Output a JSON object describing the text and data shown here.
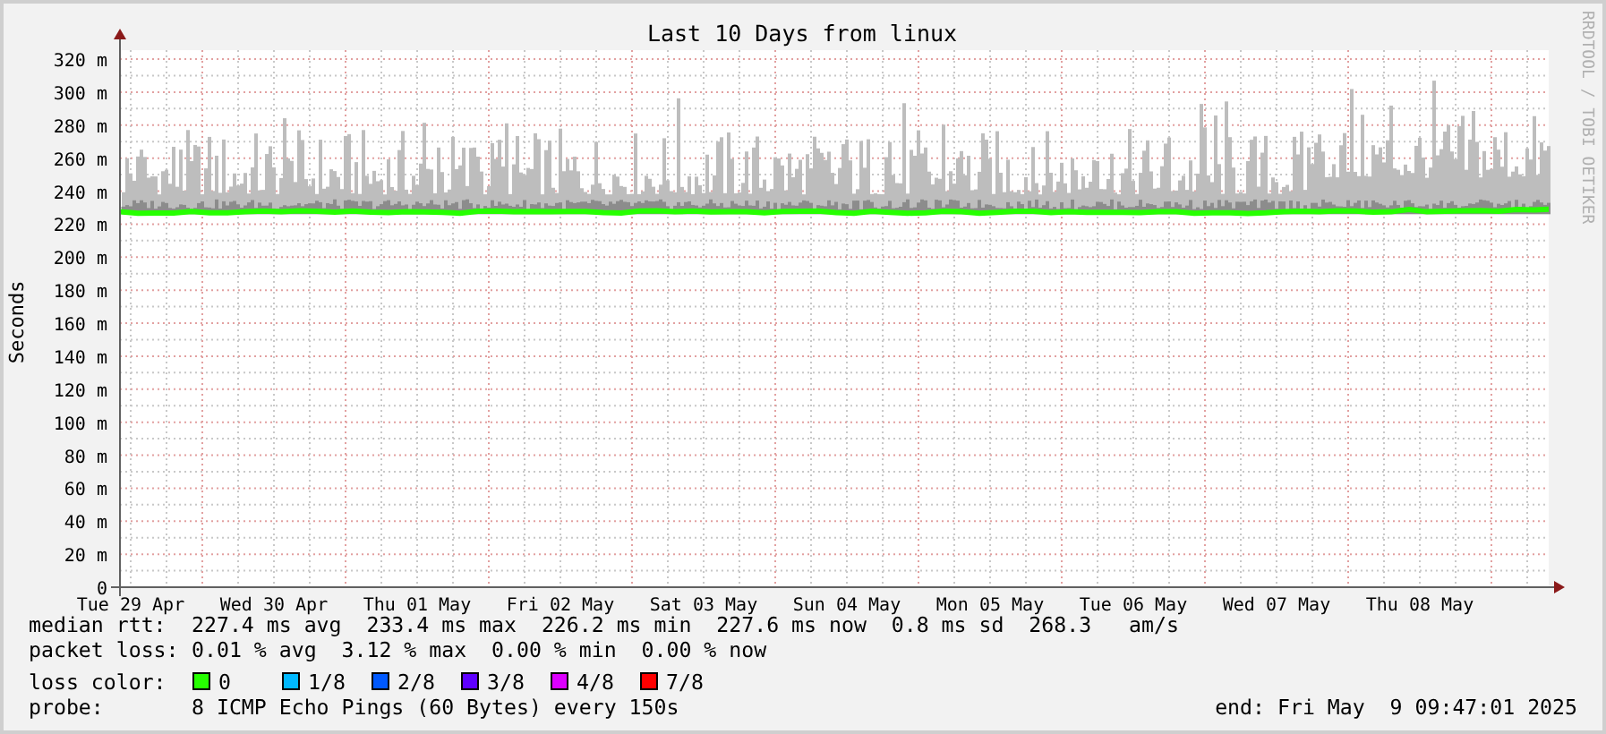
{
  "graph": {
    "title": "Last 10 Days from linux",
    "y_label": "Seconds",
    "watermark": "RRDTOOL / TOBI OETIKER",
    "y_ticks": [
      "320 m",
      "300 m",
      "280 m",
      "260 m",
      "240 m",
      "220 m",
      "200 m",
      "180 m",
      "160 m",
      "140 m",
      "120 m",
      "100 m",
      "80 m",
      "60 m",
      "40 m",
      "20 m",
      "0"
    ],
    "x_ticks": [
      "Tue 29 Apr",
      "Wed 30 Apr",
      "Thu 01 May",
      "Fri 02 May",
      "Sat 03 May",
      "Sun 04 May",
      "Mon 05 May",
      "Tue 06 May",
      "Wed 07 May",
      "Thu 08 May"
    ]
  },
  "legend": {
    "rows": [
      {
        "label": "median rtt:",
        "value": "227.4 ms avg  233.4 ms max  226.2 ms min  227.6 ms now  0.8 ms sd  268.3   am/s"
      },
      {
        "label": "packet loss:",
        "value": "0.01 % avg  3.12 % max  0.00 % min  0.00 % now"
      }
    ],
    "loss_label": "loss color:",
    "loss_colors": [
      {
        "label": "0",
        "color": "#26ff00"
      },
      {
        "label": "1/8",
        "color": "#00b8ff"
      },
      {
        "label": "2/8",
        "color": "#0059ff"
      },
      {
        "label": "3/8",
        "color": "#5e00ff"
      },
      {
        "label": "4/8",
        "color": "#dd00ff"
      },
      {
        "label": "7/8",
        "color": "#ff0000"
      }
    ],
    "probe_label": "probe:",
    "probe": "8 ICMP Echo Pings (60 Bytes) every 150s",
    "end": "end: Fri May  9 09:47:01 2025"
  }
}
